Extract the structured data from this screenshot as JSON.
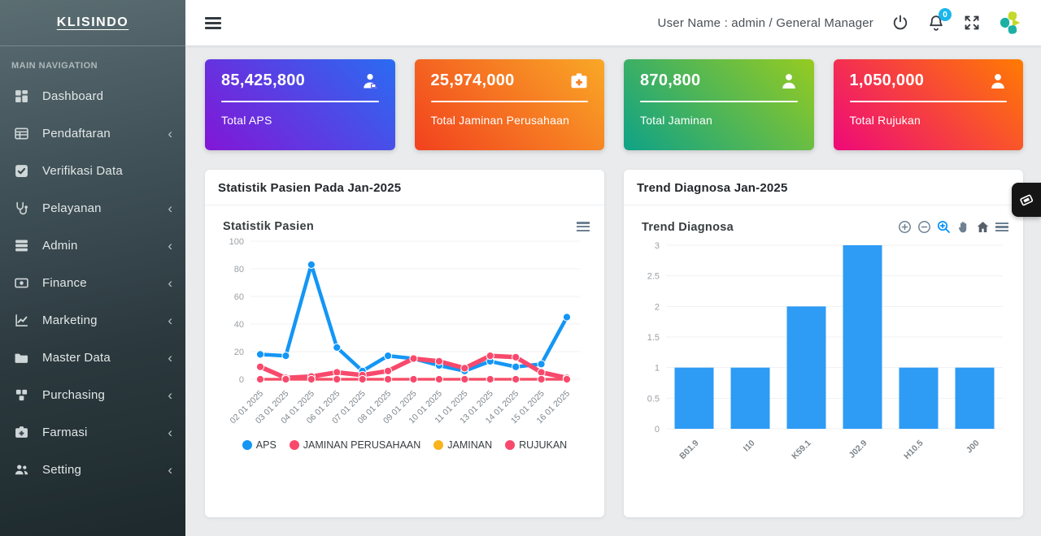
{
  "sidebar": {
    "logo_text": "KLISINDO",
    "section_label": "MAIN NAVIGATION",
    "items": [
      {
        "label": "Dashboard",
        "icon": "dashboard-grid-icon",
        "has_submenu": false
      },
      {
        "label": "Pendaftaran",
        "icon": "registration-table-icon",
        "has_submenu": true
      },
      {
        "label": "Verifikasi Data",
        "icon": "check-square-icon",
        "has_submenu": false
      },
      {
        "label": "Pelayanan",
        "icon": "stethoscope-icon",
        "has_submenu": true
      },
      {
        "label": "Admin",
        "icon": "server-icon",
        "has_submenu": true
      },
      {
        "label": "Finance",
        "icon": "money-bill-icon",
        "has_submenu": true
      },
      {
        "label": "Marketing",
        "icon": "chart-line-icon",
        "has_submenu": true
      },
      {
        "label": "Master Data",
        "icon": "folder-icon",
        "has_submenu": true
      },
      {
        "label": "Purchasing",
        "icon": "boxes-icon",
        "has_submenu": true
      },
      {
        "label": "Farmasi",
        "icon": "medkit-icon",
        "has_submenu": true
      },
      {
        "label": "Setting",
        "icon": "users-icon",
        "has_submenu": true
      }
    ]
  },
  "header": {
    "user_info": "User Name : admin / General Manager",
    "notification_count": "0",
    "icons": [
      "hamburger-menu-icon",
      "power-icon",
      "bell-icon",
      "fullscreen-expand-icon",
      "clover-logo-icon"
    ]
  },
  "stat_cards": [
    {
      "value": "85,425,800",
      "label": "Total APS",
      "icon": "doctor-user-icon",
      "gradient": [
        "#8316d6",
        "#2a6cf2"
      ]
    },
    {
      "value": "25,974,000",
      "label": "Total Jaminan Perusahaan",
      "icon": "medical-briefcase-icon",
      "gradient": [
        "#f2411e",
        "#f9a826"
      ]
    },
    {
      "value": "870,800",
      "label": "Total Jaminan",
      "icon": "user-icon",
      "gradient": [
        "#0fa287",
        "#96cb21"
      ]
    },
    {
      "value": "1,050,000",
      "label": "Total Rujukan",
      "icon": "user-icon",
      "gradient": [
        "#ee0979",
        "#ff7b02"
      ]
    }
  ],
  "panels": {
    "statistik": {
      "header": "Statistik Pasien Pada Jan-2025",
      "chart_title": "Statistik Pasien"
    },
    "trend": {
      "header": "Trend Diagnosa Jan-2025",
      "chart_title": "Trend Diagnosa",
      "toolbar_icons": [
        "zoom-in-icon",
        "zoom-out-icon",
        "selection-zoom-icon",
        "pan-hand-icon",
        "home-reset-icon",
        "chart-menu-icon"
      ]
    }
  },
  "chart_data": [
    {
      "type": "line",
      "title": "Statistik Pasien",
      "x": [
        "02 01 2025",
        "03 01 2025",
        "04 01 2025",
        "06 01 2025",
        "07 01 2025",
        "08 01 2025",
        "09 01 2025",
        "10 01 2025",
        "11 01 2025",
        "13 01 2025",
        "14 01 2025",
        "15 01 2025",
        "16 01 2025"
      ],
      "series": [
        {
          "name": "APS",
          "color": "#1496f5",
          "values": [
            18,
            17,
            83,
            23,
            6,
            17,
            15,
            10,
            6,
            13,
            9,
            11,
            45
          ]
        },
        {
          "name": "JAMINAN PERUSAHAAN",
          "color": "#f8496c",
          "values": [
            9,
            1,
            2,
            5,
            3,
            6,
            15,
            13,
            8,
            17,
            16,
            5,
            1
          ]
        },
        {
          "name": "JAMINAN",
          "color": "#f8b31d",
          "values": [
            0,
            0,
            0,
            0,
            0,
            0,
            0,
            0,
            0,
            0,
            0,
            0,
            0
          ]
        },
        {
          "name": "RUJUKAN",
          "color": "#f8496c",
          "values": [
            0,
            0,
            0,
            0,
            0,
            0,
            0,
            0,
            0,
            0,
            0,
            0,
            0
          ]
        }
      ],
      "ylim": [
        0,
        100
      ],
      "yticks": [
        0,
        20,
        40,
        60,
        80,
        100
      ],
      "legend_position": "bottom",
      "grid": true
    },
    {
      "type": "bar",
      "title": "Trend Diagnosa",
      "categories": [
        "B01.9",
        "I10",
        "K59.1",
        "J02.9",
        "H10.5",
        "J00"
      ],
      "values": [
        1,
        1,
        2,
        3,
        1,
        1
      ],
      "bar_color": "#2e9bf5",
      "ylim": [
        0,
        3
      ],
      "yticks": [
        0,
        0.5,
        1,
        1.5,
        2,
        2.5,
        3
      ],
      "grid": true
    }
  ],
  "floating_button": {
    "icon": "ticket-icon"
  }
}
